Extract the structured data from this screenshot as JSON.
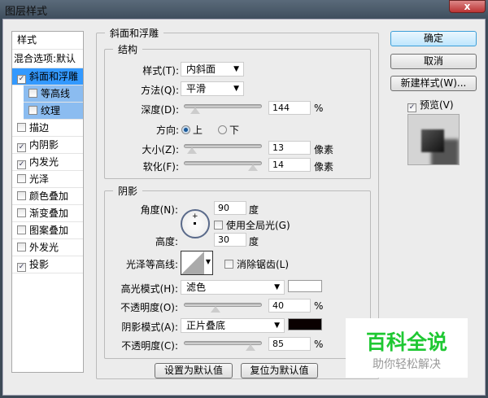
{
  "window": {
    "title": "图层样式",
    "close": "x"
  },
  "styles_list": {
    "header": "样式",
    "blend": "混合选项:默认",
    "items": [
      {
        "label": "斜面和浮雕",
        "checked": true
      },
      {
        "label": "等高线",
        "checked": false
      },
      {
        "label": "纹理",
        "checked": false
      },
      {
        "label": "描边",
        "checked": false
      },
      {
        "label": "内阴影",
        "checked": true
      },
      {
        "label": "内发光",
        "checked": true
      },
      {
        "label": "光泽",
        "checked": false
      },
      {
        "label": "颜色叠加",
        "checked": false
      },
      {
        "label": "渐变叠加",
        "checked": false
      },
      {
        "label": "图案叠加",
        "checked": false
      },
      {
        "label": "外发光",
        "checked": false
      },
      {
        "label": "投影",
        "checked": true
      }
    ]
  },
  "bevel": {
    "title": "斜面和浮雕",
    "structure": {
      "title": "结构",
      "style_label": "样式(T):",
      "style_value": "内斜面",
      "technique_label": "方法(Q):",
      "technique_value": "平滑",
      "depth_label": "深度(D):",
      "depth_value": "144",
      "percent": "%",
      "direction_label": "方向:",
      "up": "上",
      "down": "下",
      "size_label": "大小(Z):",
      "size_value": "13",
      "px": "像素",
      "soften_label": "软化(F):",
      "soften_value": "14"
    },
    "shading": {
      "title": "阴影",
      "angle_label": "角度(N):",
      "angle_value": "90",
      "deg": "度",
      "global_light": "使用全局光(G)",
      "altitude_label": "高度:",
      "altitude_value": "30",
      "gloss_label": "光泽等高线:",
      "antialias": "消除锯齿(L)",
      "highlight_label": "高光模式(H):",
      "highlight_value": "滤色",
      "highlight_color": "#ffffff",
      "hl_opacity_label": "不透明度(O):",
      "hl_opacity_value": "40",
      "shadow_label": "阴影模式(A):",
      "shadow_value": "正片叠底",
      "shadow_color": "#0a0000",
      "sh_opacity_label": "不透明度(C):",
      "sh_opacity_value": "85"
    },
    "make_default": "设置为默认值",
    "reset_default": "复位为默认值"
  },
  "buttons": {
    "ok": "确定",
    "cancel": "取消",
    "new_style": "新建样式(W)...",
    "preview": "预览(V)"
  },
  "watermark": {
    "title": "百科全说",
    "subtitle": "助你轻松解决"
  }
}
